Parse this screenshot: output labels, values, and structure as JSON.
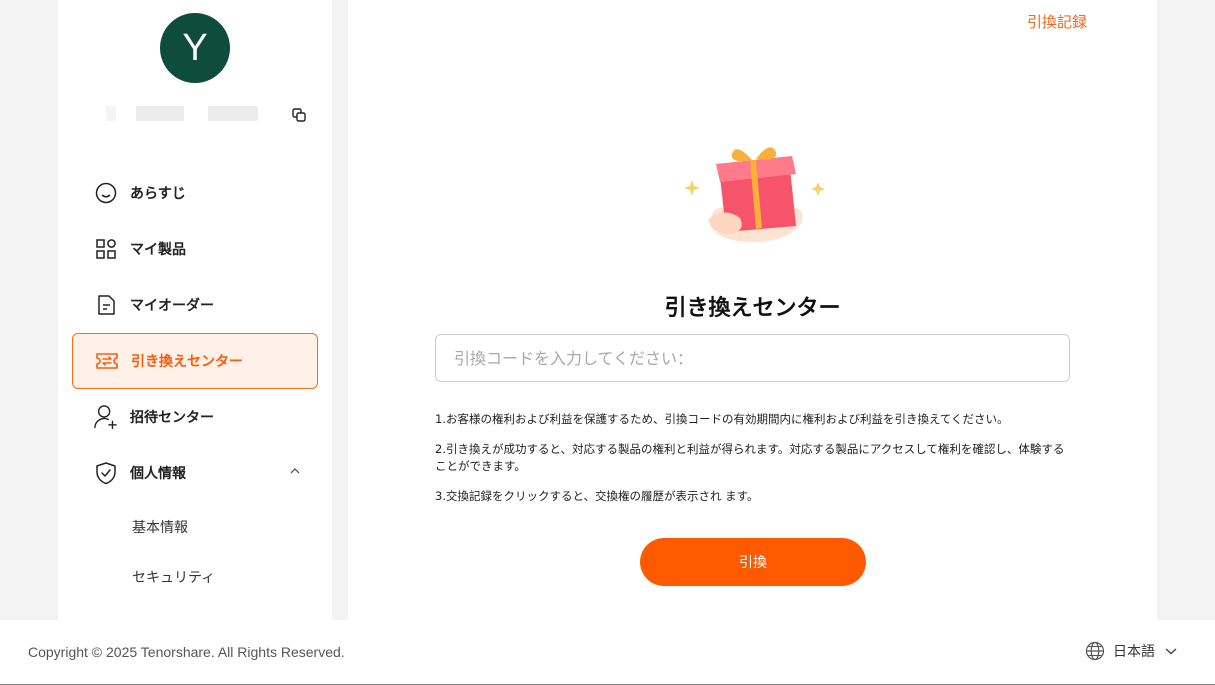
{
  "sidebar": {
    "avatar_letter": "Y",
    "nav": [
      {
        "label": "あらすじ",
        "icon": "smile-icon"
      },
      {
        "label": "マイ製品",
        "icon": "grid-icon"
      },
      {
        "label": "マイオーダー",
        "icon": "document-icon"
      },
      {
        "label": "引き換えセンター",
        "icon": "ticket-icon",
        "active": true
      },
      {
        "label": "招待センター",
        "icon": "user-add-icon"
      },
      {
        "label": "個人情報",
        "icon": "shield-check-icon",
        "expanded": true
      }
    ],
    "sub_items": [
      "基本情報",
      "セキュリティ"
    ]
  },
  "main": {
    "history_link": "引換記録",
    "title": "引き換えセンター",
    "code_placeholder": "引換コードを入力してください：",
    "notes": [
      "1.お客様の権利および利益を保護するため、引換コードの有効期間内に権利および利益を引き換えてください。",
      "2.引き換えが成功すると、対応する製品の権利と利益が得られます。対応する製品にアクセスして権利を確認し、体験することができます。",
      "3.交換記録をクリックすると、交換権の履歴が表示され ます。"
    ],
    "redeem_button": "引換"
  },
  "footer": {
    "copyright": "Copyright © 2025 Tenorshare. All Rights Reserved.",
    "language": "日本語"
  },
  "colors": {
    "accent": "#ff5a00",
    "avatar_bg": "#0e4d3c",
    "active_bg": "#fff0e8"
  }
}
